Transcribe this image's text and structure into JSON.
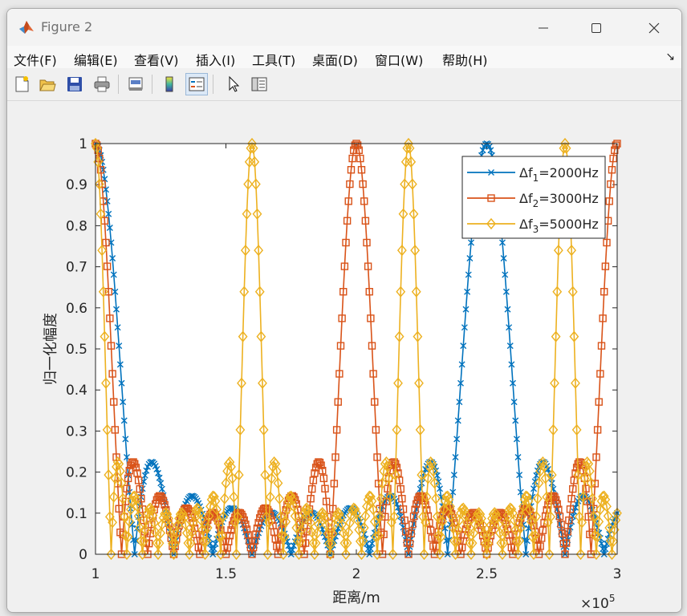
{
  "window": {
    "title": "Figure 2"
  },
  "menu": [
    "文件(F)",
    "编辑(E)",
    "查看(V)",
    "插入(I)",
    "工具(T)",
    "桌面(D)",
    "窗口(W)",
    "帮助(H)"
  ],
  "toolbar": {
    "icons": [
      "new-figure-icon",
      "open-file-icon",
      "save-icon",
      "print-icon",
      "print-preview-icon",
      "colorbar-icon",
      "legend-icon",
      "pointer-icon",
      "property-editor-icon"
    ]
  },
  "chart_data": {
    "type": "line",
    "title": "",
    "xlabel": "距离/m",
    "ylabel": "归一化幅度",
    "x_exponent_label": "×10",
    "x_exponent_power": "5",
    "xlim": [
      1,
      3
    ],
    "ylim": [
      0,
      1
    ],
    "xticks": [
      "1",
      "1.5",
      "2",
      "2.5",
      "3"
    ],
    "yticks": [
      "0",
      "0.1",
      "0.2",
      "0.3",
      "0.4",
      "0.5",
      "0.6",
      "0.7",
      "0.8",
      "0.9",
      "1"
    ],
    "legend_position": "top-right",
    "series": [
      {
        "name": "Δf1=2000Hz",
        "label_prefix": "Δf",
        "label_sub": "1",
        "label_suffix": "=2000Hz",
        "color": "#0072BD",
        "marker": "x",
        "period": 1.5
      },
      {
        "name": "Δf2=3000Hz",
        "label_prefix": "Δf",
        "label_sub": "2",
        "label_suffix": "=3000Hz",
        "color": "#D95319",
        "marker": "square",
        "period": 1.0
      },
      {
        "name": "Δf3=5000Hz",
        "label_prefix": "Δf",
        "label_sub": "3",
        "label_suffix": "=5000Hz",
        "color": "#EDB120",
        "marker": "diamond",
        "period": 0.6
      }
    ]
  }
}
